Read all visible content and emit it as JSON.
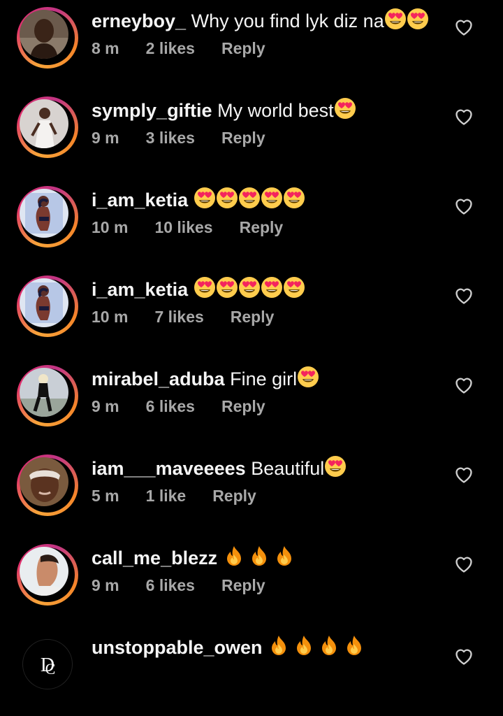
{
  "comments": [
    {
      "username": "erneyboy_",
      "text": "Why you find lyk diz na",
      "emojis": [
        "heart-eyes",
        "heart-eyes"
      ],
      "time": "8 m",
      "likes": "2 likes",
      "reply": "Reply",
      "avatar": "photo-man-dark"
    },
    {
      "username": "symply_giftie",
      "text": "My world best",
      "emojis": [
        "heart-eyes"
      ],
      "time": "9 m",
      "likes": "3 likes",
      "reply": "Reply",
      "avatar": "photo-woman-white-dress"
    },
    {
      "username": "i_am_ketia",
      "text": "",
      "emojis": [
        "heart-eyes",
        "heart-eyes",
        "heart-eyes",
        "heart-eyes",
        "heart-eyes"
      ],
      "time": "10 m",
      "likes": "10 likes",
      "reply": "Reply",
      "avatar": "illustration-woman"
    },
    {
      "username": "i_am_ketia",
      "text": "",
      "emojis": [
        "heart-eyes",
        "heart-eyes",
        "heart-eyes",
        "heart-eyes",
        "heart-eyes"
      ],
      "time": "10 m",
      "likes": "7 likes",
      "reply": "Reply",
      "avatar": "illustration-woman"
    },
    {
      "username": "mirabel_aduba",
      "text": "Fine girl",
      "emojis": [
        "heart-eyes"
      ],
      "time": "9 m",
      "likes": "6 likes",
      "reply": "Reply",
      "avatar": "photo-woman-blonde"
    },
    {
      "username": "iam___maveeees",
      "text": "Beautiful",
      "emojis": [
        "heart-eyes"
      ],
      "time": "5 m",
      "likes": "1 like",
      "reply": "Reply",
      "avatar": "photo-woman-headband"
    },
    {
      "username": "call_me_blezz",
      "text": "",
      "emojis": [
        "fire",
        "fire",
        "fire"
      ],
      "time": "9 m",
      "likes": "6 likes",
      "reply": "Reply",
      "avatar": "photo-man-profile"
    },
    {
      "username": "unstoppable_owen",
      "text": "",
      "emojis": [
        "fire",
        "fire",
        "fire",
        "fire"
      ],
      "time": "",
      "likes": "",
      "reply": "",
      "avatar": "logo-dc"
    }
  ],
  "icons": {
    "like": "heart-outline-icon"
  },
  "colors": {
    "background": "#000000",
    "text": "#f5f5f5",
    "meta": "#a8a8a8",
    "story_ring": "#e1306c"
  }
}
